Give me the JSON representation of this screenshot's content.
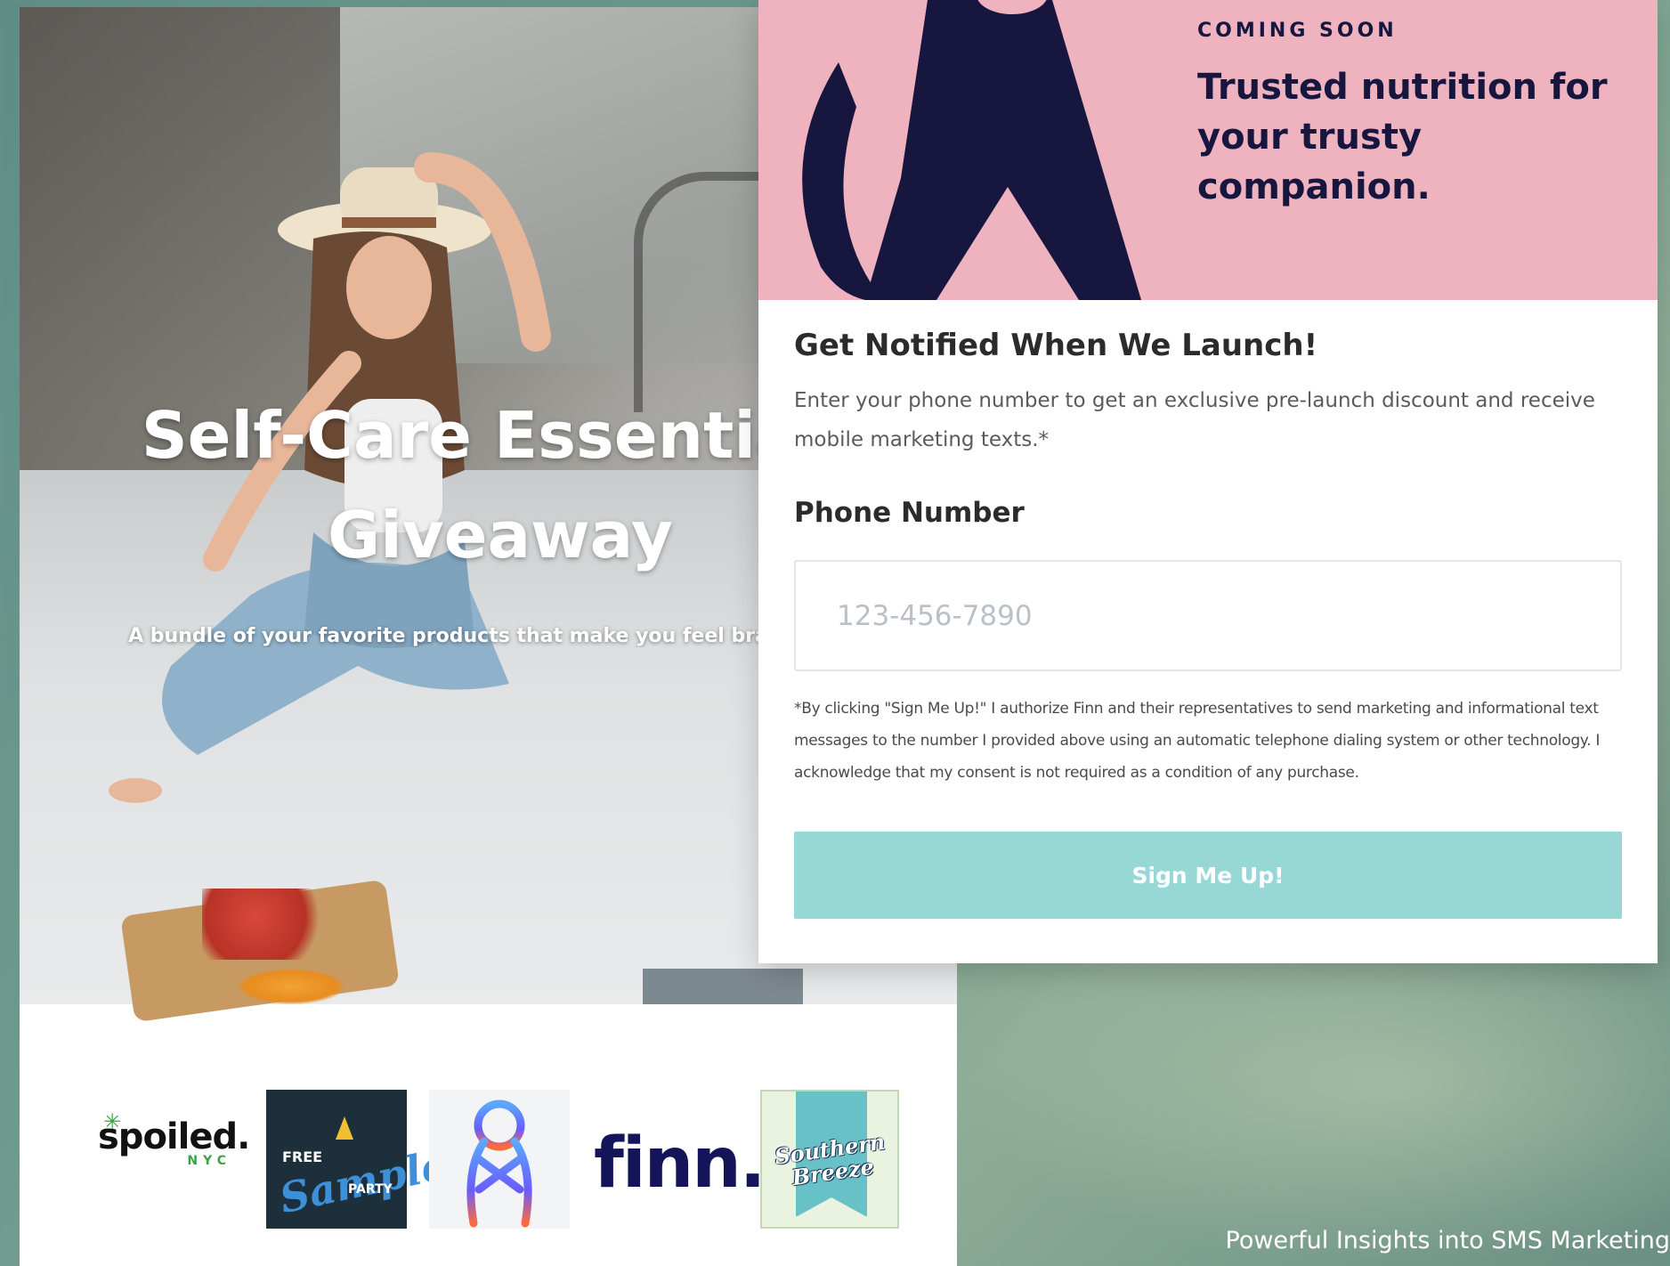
{
  "landing": {
    "hero_title": "Self-Care Essentials\nGiveaway",
    "hero_subtitle": "A bundle of your favorite products that make you feel brand new",
    "logos": {
      "spoiled": {
        "word": "spoiled.",
        "sub": "NYC"
      },
      "free_sample_party": {
        "free": "FREE",
        "sample": "Sample",
        "party": "PARTY"
      },
      "finn": {
        "word": "finn."
      },
      "southern_breeze": {
        "script": "Southern\nBreeze"
      }
    }
  },
  "popup": {
    "eyebrow": "COMING SOON",
    "tagline": "Trusted nutrition for\nyour trusty companion.",
    "heading": "Get Notified When We Launch!",
    "description": "Enter your phone number to get an  exclusive pre-launch discount and receive mobile marketing texts.*",
    "phone_label": "Phone Number",
    "phone_placeholder": "123-456-7890",
    "phone_value": "",
    "disclaimer": "*By clicking \"Sign Me Up!\" I authorize Finn and their representatives to send marketing and informational text messages to the number I provided above using an automatic telephone dialing system or other technology. I acknowledge that my consent is not required as a condition of any purchase.",
    "button_label": "Sign Me Up!"
  },
  "caption": "Powerful Insights into SMS Marketing",
  "colors": {
    "banner_pink": "#efb3c0",
    "navy": "#17163f",
    "button_teal": "#97d8d7",
    "placeholder_gray": "#b9c0c8"
  },
  "icons": {
    "dog_illustration": "sitting-dog-silhouette",
    "infinity_logo": "figure-eight-loop"
  }
}
